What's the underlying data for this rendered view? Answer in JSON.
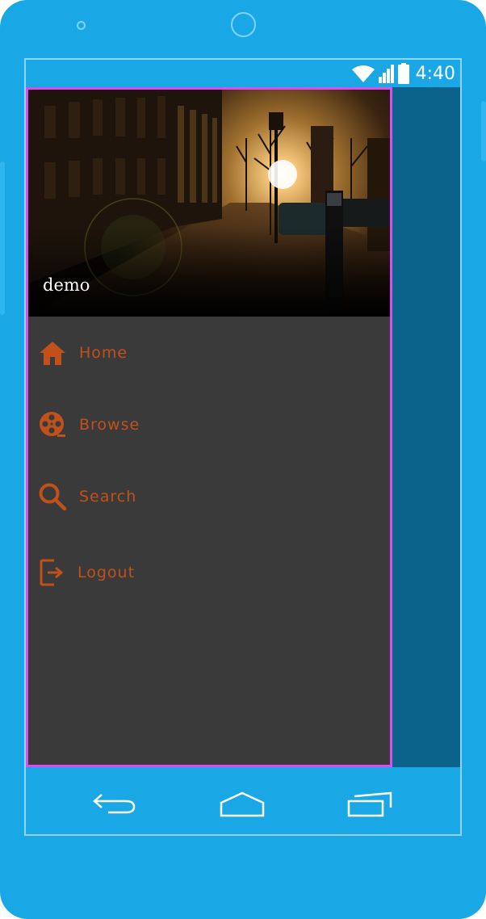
{
  "status_bar": {
    "time": "4:40",
    "icons": [
      "wifi-icon",
      "signal-icon",
      "battery-icon"
    ]
  },
  "drawer": {
    "header_name": "demo",
    "menu": [
      {
        "label": "Home",
        "icon": "home-icon"
      },
      {
        "label": "Browse",
        "icon": "film-reel-icon"
      },
      {
        "label": "Search",
        "icon": "search-icon"
      },
      {
        "label": "Logout",
        "icon": "logout-icon"
      }
    ]
  },
  "nav_bar": {
    "buttons": [
      "back-icon",
      "home-outline-icon",
      "recents-icon"
    ]
  },
  "colors": {
    "device": "#1aa7e6",
    "app_background": "#0b628a",
    "drawer_background": "#3a3a3a",
    "drawer_outline": "#d84ef0",
    "menu_accent": "#c0511a"
  }
}
